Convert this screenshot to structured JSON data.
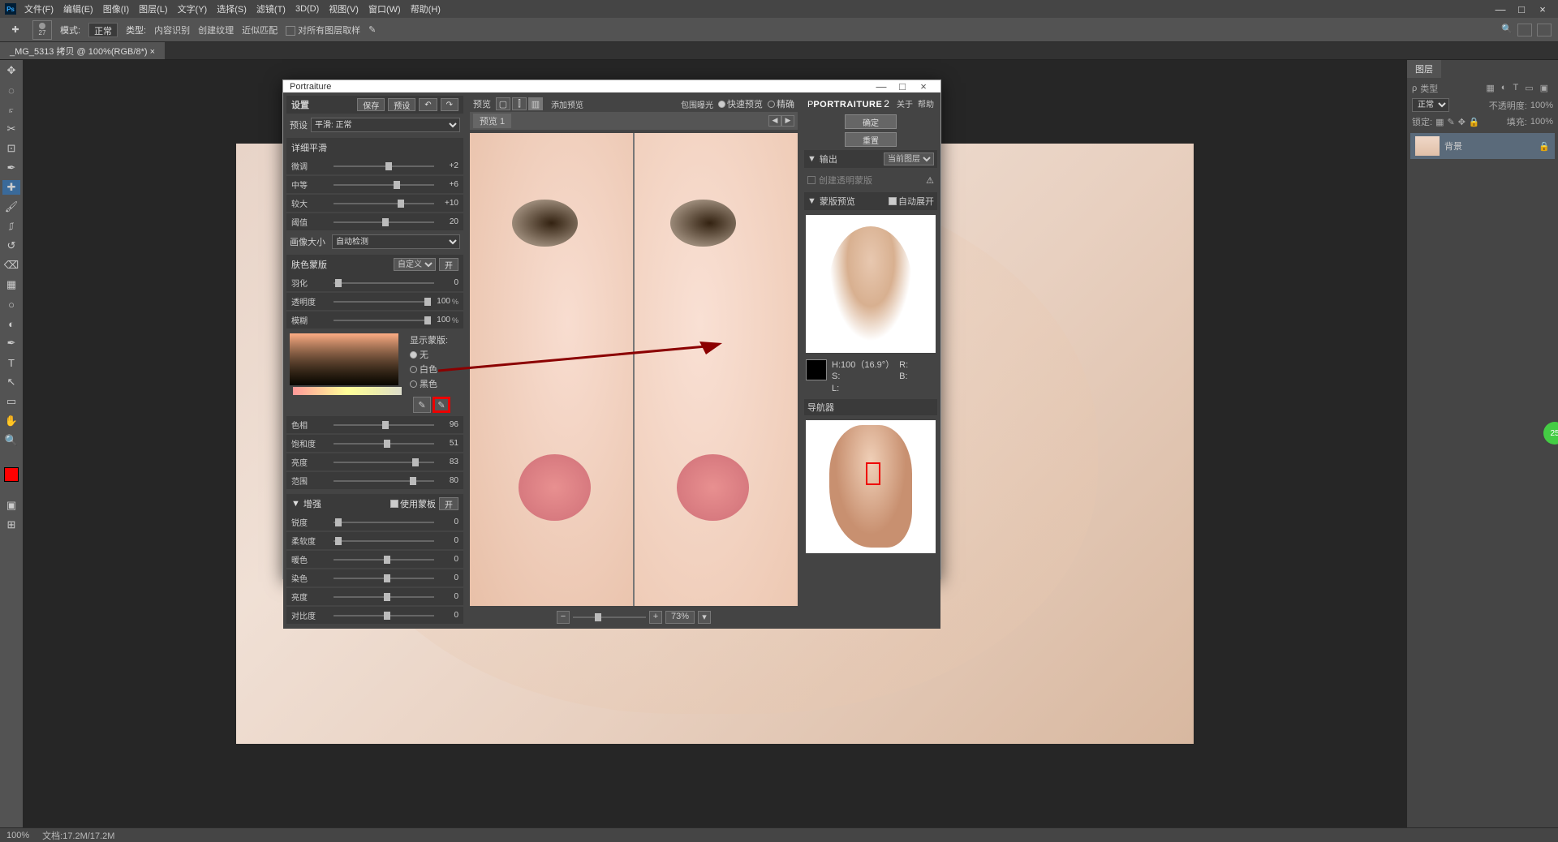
{
  "menubar": {
    "items": [
      "文件(F)",
      "编辑(E)",
      "图像(I)",
      "图层(L)",
      "文字(Y)",
      "选择(S)",
      "滤镜(T)",
      "3D(D)",
      "视图(V)",
      "窗口(W)",
      "帮助(H)"
    ]
  },
  "optionsbar": {
    "brush_size": "27",
    "mode_label": "模式:",
    "mode_value": "正常",
    "type_label": "类型:",
    "type_opts": [
      "内容识别",
      "创建纹理",
      "近似匹配"
    ],
    "sample_all": "对所有图层取样"
  },
  "doctab": "_MG_5313 拷贝 @ 100%(RGB/8*) ×",
  "layers": {
    "tab": "图层",
    "kind_label": "类型",
    "blend": "正常",
    "opacity_label": "不透明度:",
    "opacity_val": "100%",
    "lock_label": "锁定:",
    "fill_label": "填充:",
    "fill_val": "100%",
    "row_name": "背景"
  },
  "statusbar": {
    "zoom": "100%",
    "docinfo": "文档:17.2M/17.2M"
  },
  "dialog": {
    "title": "Portraiture",
    "settings_label": "设置",
    "save_btn": "保存",
    "preset_btn": "预设",
    "preset_label": "预设",
    "preset_value": "平滑: 正常",
    "smoothing": {
      "title": "详细平滑",
      "rows": [
        {
          "label": "微调",
          "val": "+2",
          "pos": 52
        },
        {
          "label": "中等",
          "val": "+6",
          "pos": 60
        },
        {
          "label": "较大",
          "val": "+10",
          "pos": 64
        },
        {
          "label": "阈值",
          "val": "20",
          "pos": 48
        }
      ],
      "portrait_size_label": "画像大小",
      "portrait_size_value": "自动检测"
    },
    "skinmask": {
      "title": "肤色蒙版",
      "custom_label": "自定义",
      "on_btn": "开",
      "rows": [
        {
          "label": "羽化",
          "val": "0",
          "pos": 2
        },
        {
          "label": "透明度",
          "val": "100",
          "unit": "%",
          "pos": 98
        },
        {
          "label": "模糊",
          "val": "100",
          "unit": "%",
          "pos": 98
        }
      ],
      "showmask_label": "显示蒙版:",
      "radio_opts": [
        "无",
        "白色",
        "黑色"
      ],
      "hsv_rows": [
        {
          "label": "色相",
          "val": "96",
          "pos": 48
        },
        {
          "label": "饱和度",
          "val": "51",
          "pos": 50
        },
        {
          "label": "亮度",
          "val": "83",
          "pos": 78
        },
        {
          "label": "范围",
          "val": "80",
          "pos": 76
        }
      ]
    },
    "enhance": {
      "title": "增强",
      "use_mask": "使用蒙板",
      "on_btn": "开",
      "rows": [
        {
          "label": "锐度",
          "val": "0",
          "pos": 2
        },
        {
          "label": "柔软度",
          "val": "0",
          "pos": 2
        },
        {
          "label": "暖色",
          "val": "0",
          "pos": 50
        },
        {
          "label": "染色",
          "val": "0",
          "pos": 50
        },
        {
          "label": "亮度",
          "val": "0",
          "pos": 50
        },
        {
          "label": "对比度",
          "val": "0",
          "pos": 50
        }
      ]
    },
    "preview": {
      "label": "预览",
      "add_preview": "添加预览",
      "export": "包围曝光",
      "fast_preview": "快速预览",
      "precise": "精确",
      "tab": "预览 1",
      "zoom": "73%"
    },
    "right": {
      "brand": "PORTRAITURE",
      "version": "2",
      "about": "关于",
      "help": "帮助",
      "ok": "确定",
      "reset": "重置",
      "output_label": "输出",
      "output_value": "当前图层",
      "create_mask": "创建透明蒙版",
      "mask_preview_label": "蒙版预览",
      "auto_expand": "自动展开",
      "H": "H:100（16.9°）",
      "S": "S:",
      "L": "L:",
      "R": "R:",
      "G": "",
      "B": "B:",
      "nav_label": "导航器"
    }
  },
  "assist_badge": "25"
}
